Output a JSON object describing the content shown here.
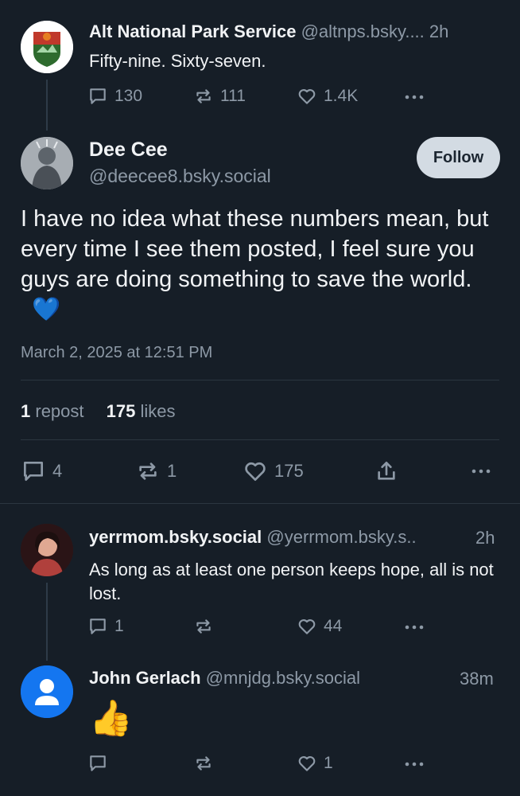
{
  "post1": {
    "name": "Alt National Park Service",
    "handle": "@altnps.bsky.... 2h",
    "text": "Fifty-nine. Sixty-seven.",
    "replies": "130",
    "reposts": "111",
    "likes": "1.4K"
  },
  "main": {
    "name": "Dee Cee",
    "handle": "@deecee8.bsky.social",
    "follow_label": "Follow",
    "text": "I have no idea what these numbers mean, but every time I see them posted, I feel sure you guys are doing something to save the world.",
    "emoji": "💙",
    "timestamp": "March 2, 2025 at 12:51 PM",
    "repost_count": "1",
    "repost_label": "repost",
    "like_count": "175",
    "like_label": "likes",
    "replies": "4",
    "reposts": "1",
    "likes": "175"
  },
  "reply1": {
    "name": "yerrmom.bsky.social",
    "handle": "@yerrmom.bsky.s..",
    "time": "2h",
    "text": "As long as at least one person keeps hope, all is not lost.",
    "replies": "1",
    "likes": "44"
  },
  "reply2": {
    "name": "John Gerlach",
    "handle": "@mnjdg.bsky.social",
    "time": "38m",
    "emoji": "👍",
    "likes": "1"
  },
  "colors": {
    "background": "#161e27",
    "muted": "#8d99a6",
    "heart": "#2d89ef"
  }
}
